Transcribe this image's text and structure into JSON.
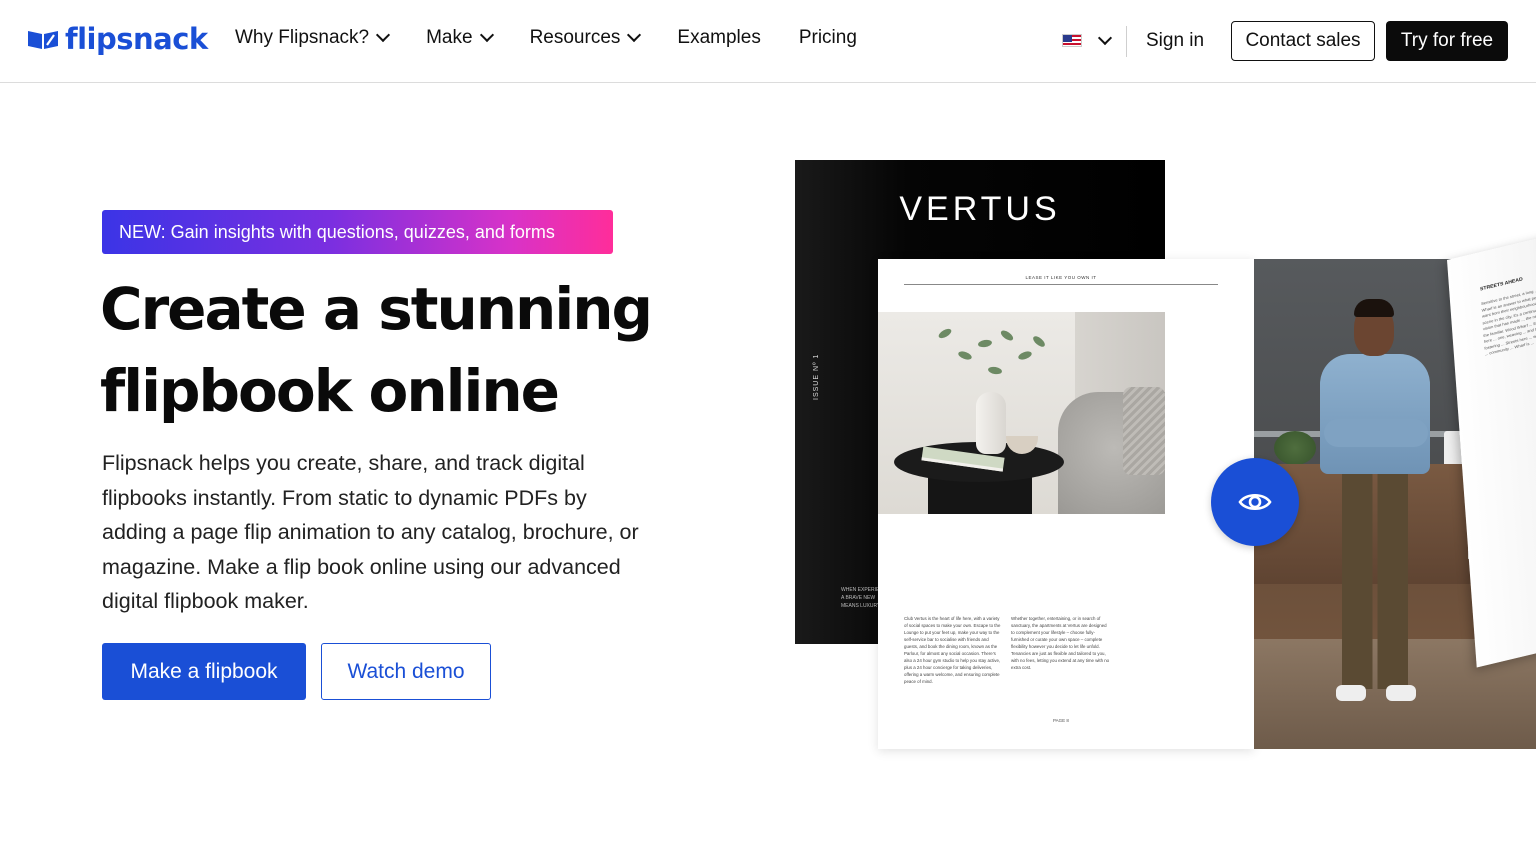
{
  "header": {
    "logo_text": "flipsnack",
    "nav": [
      {
        "label": "Why Flipsnack?",
        "has_dropdown": true
      },
      {
        "label": "Make",
        "has_dropdown": true
      },
      {
        "label": "Resources",
        "has_dropdown": true
      },
      {
        "label": "Examples",
        "has_dropdown": false
      },
      {
        "label": "Pricing",
        "has_dropdown": false
      }
    ],
    "language_icon": "us-flag-icon",
    "sign_in": "Sign in",
    "contact_sales": "Contact sales",
    "try_free": "Try for free"
  },
  "hero": {
    "badge": "NEW: Gain insights with questions, quizzes, and forms",
    "title_line1": "Create a stunning",
    "title_line2": "flipbook online",
    "description": "Flipsnack helps you create, share, and track digital flipbooks instantly. From static to dynamic PDFs by adding a page flip animation to any catalog, brochure, or magazine. Make a flip book online using our advanced digital flipbook maker.",
    "primary_button": "Make a flipbook",
    "secondary_button": "Watch demo"
  },
  "illustration": {
    "cover_title": "VERTUS",
    "cover_issue": "ISSUE Nº 1",
    "cover_when": "WHEN EXPERIEN",
    "cover_brave": "A BRAVE NEW",
    "cover_means": "MEANS LUXURY IS",
    "page_heading": "LEASE IT LIKE YOU OWN IT",
    "page_text_col1": "Club Vertus is the heart of life here, with a variety of social spaces to make your own. Escape to the Lounge to put your feet up, make your way to the self-service bar to socialise with friends and guests, and book the dining room, known as the Parlour, for almost any social occasion. There's also a 24 hour gym studio to help you stay active, plus a 24 hour concierge for taking deliveries, offering a warm welcome, and ensuring complete peace of mind.",
    "page_text_col2": "Whether together, entertaining, or in search of sanctuary, the apartments at Vertus are designed to complement your lifestyle – choose fully-furnished or curate your own space – complete flexibility however you decide to let life unfold. Tenancies are just as flexible and tailored to you, with no fees, letting you extend at any time with no extra cost.",
    "page_number": "PAGE 8",
    "flip_heading": "STREETS AHEAD",
    "flip_text": "Sensitive to the street, a long ... Wood Wharf is an answer to what people want from their neighbourhood. A new scene in the city, it's a continuation of a vision that has made ... the new and the familiar. Wood Wharf ... Everything here ... one, weaving ... and the ... fostering ... Streets here ... welcoming ... community ... Wharf is ...",
    "eye_icon": "eye-icon",
    "accent_color": "#1a4fd6"
  }
}
